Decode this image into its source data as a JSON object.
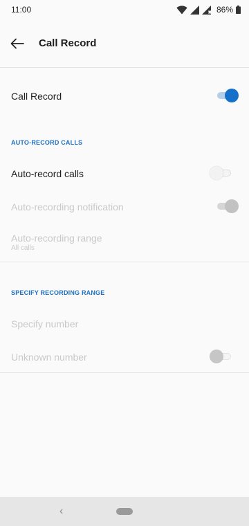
{
  "status_bar": {
    "time": "11:00",
    "battery_percent": "86%"
  },
  "header": {
    "title": "Call Record"
  },
  "call_record": {
    "label": "Call Record",
    "enabled": true
  },
  "auto_record_section": {
    "header": "AUTO-RECORD CALLS",
    "auto_record_calls": {
      "label": "Auto-record calls",
      "enabled": false
    },
    "notification": {
      "label": "Auto-recording notification",
      "enabled": true,
      "disabled": true
    },
    "range": {
      "label": "Auto-recording range",
      "value": "All calls",
      "disabled": true
    }
  },
  "specify_section": {
    "header": "SPECIFY RECORDING RANGE",
    "specify_number": {
      "label": "Specify number",
      "disabled": true
    },
    "unknown_number": {
      "label": "Unknown number",
      "enabled": false,
      "disabled": true
    }
  },
  "colors": {
    "accent": "#1470c9",
    "section_header": "#1f70c0",
    "disabled_text": "#c9c9c9"
  },
  "icons": {
    "back": "arrow-left-icon",
    "wifi": "wifi-icon",
    "signal": "cell-signal-icon",
    "battery": "battery-icon"
  }
}
